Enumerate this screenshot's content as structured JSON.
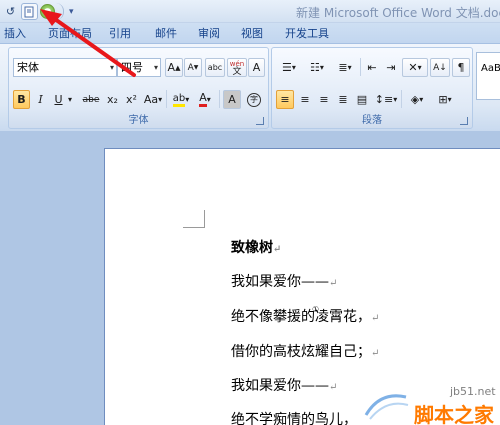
{
  "window": {
    "title": "新建 Microsoft Office Word 文档.docx -"
  },
  "qat": {
    "more_label": "▾"
  },
  "tabs": [
    "插入",
    "页面布局",
    "引用",
    "邮件",
    "审阅",
    "视图",
    "开发工具"
  ],
  "font_group": {
    "label": "字体",
    "font_name": "宋体",
    "font_size": "四号",
    "grow_label": "A",
    "shrink_label": "A",
    "phonetic_label": "abc",
    "pinyin_label": "wén",
    "border_label": "A",
    "bold": "B",
    "italic": "I",
    "underline": "U",
    "strike": "abe",
    "subscript": "x₂",
    "superscript": "x²",
    "case": "Aa",
    "highlight": "ab",
    "font_color": "A",
    "char_shading": "A",
    "enclose": "字"
  },
  "paragraph_group": {
    "label": "段落"
  },
  "styles": {
    "sample": "AaBb"
  },
  "document": {
    "lines": [
      "致橡树",
      "我如果爱你——",
      "绝不像攀援的凌霄花，",
      "借你的高枝炫耀自己；",
      "我如果爱你——",
      "绝不学痴情的鸟儿，"
    ],
    "footnote_mark": "①",
    "para_mark": "↵"
  },
  "watermark": {
    "url": "jb51.net",
    "text": "脚本之家"
  },
  "colors": {
    "accent": "#15428b",
    "arrow": "#e8171b",
    "highlight": "#ffe600",
    "font_color": "#e02020"
  }
}
